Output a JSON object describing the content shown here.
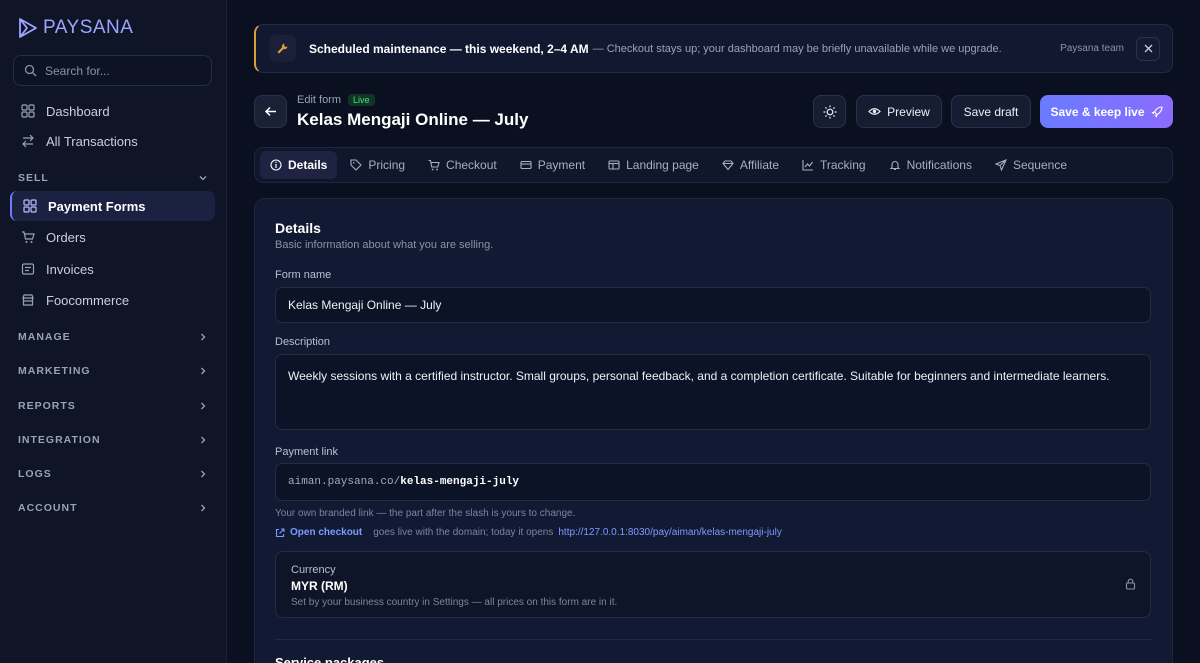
{
  "brand": {
    "name": "PAYSANA"
  },
  "search": {
    "placeholder": "Search for..."
  },
  "sidebar": {
    "top_items": [
      {
        "label": "Dashboard",
        "icon": "grid-icon"
      },
      {
        "label": "All Transactions",
        "icon": "transfer-icon"
      }
    ],
    "sell_section": "SELL",
    "sell_items": [
      {
        "label": "Payment Forms",
        "icon": "grid-icon",
        "active": true
      },
      {
        "label": "Orders",
        "icon": "cart-icon"
      },
      {
        "label": "Invoices",
        "icon": "invoice-icon"
      },
      {
        "label": "Foocommerce",
        "icon": "store-icon"
      }
    ],
    "sections": [
      "MANAGE",
      "MARKETING",
      "REPORTS",
      "INTEGRATION",
      "LOGS",
      "ACCOUNT"
    ]
  },
  "banner": {
    "title": "Scheduled maintenance — this weekend, 2–4 AM",
    "message": "— Checkout stays up; your dashboard may be briefly unavailable while we upgrade.",
    "team": "Paysana team",
    "accent": "#d6a13a"
  },
  "header": {
    "edit_label": "Edit form",
    "badge": "Live",
    "title": "Kelas Mengaji Online — July",
    "preview_label": "Preview",
    "draft_label": "Save draft",
    "save_label": "Save & keep live"
  },
  "tabs": [
    {
      "label": "Details",
      "icon": "info-icon",
      "active": true
    },
    {
      "label": "Pricing",
      "icon": "tag-icon"
    },
    {
      "label": "Checkout",
      "icon": "cart-icon"
    },
    {
      "label": "Payment",
      "icon": "card-icon"
    },
    {
      "label": "Landing page",
      "icon": "layout-icon"
    },
    {
      "label": "Affiliate",
      "icon": "gem-icon"
    },
    {
      "label": "Tracking",
      "icon": "chart-icon"
    },
    {
      "label": "Notifications",
      "icon": "bell-icon"
    },
    {
      "label": "Sequence",
      "icon": "send-icon"
    }
  ],
  "details": {
    "title": "Details",
    "subtitle": "Basic information about what you are selling.",
    "form_name_label": "Form name",
    "form_name_value": "Kelas Mengaji Online — July",
    "description_label": "Description",
    "description_value": "Weekly sessions with a certified instructor. Small groups, personal feedback, and a completion certificate. Suitable for beginners and intermediate learners.",
    "payment_link_label": "Payment link",
    "link_prefix": "aiman.paysana.co/",
    "link_slug": "kelas-mengaji-july",
    "link_hint": "Your own branded link — the part after the slash is yours to change.",
    "open_checkout": "Open checkout",
    "checkout_note": "goes live with the domain; today it opens",
    "checkout_url": "http://127.0.0.1:8030/pay/aiman/kelas-mengaji-july",
    "currency_label": "Currency",
    "currency_value": "MYR (RM)",
    "currency_note": "Set by your business country in Settings — all prices on this form are in it.",
    "next_section": "Service packages"
  }
}
